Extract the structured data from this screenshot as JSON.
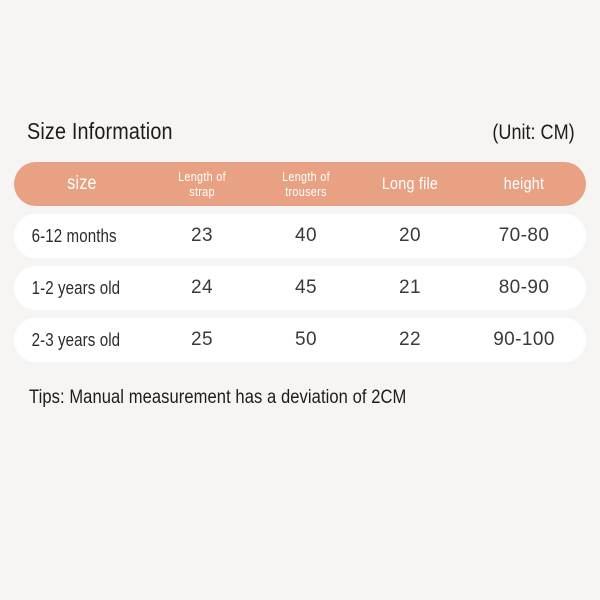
{
  "page": {
    "background_color": "#F7F5F4",
    "text_color": "#1C1C1C"
  },
  "header": {
    "title": "Size Information",
    "unit_note": "(Unit: CM)"
  },
  "table": {
    "accent_color": "#E8A182",
    "row_background": "#FFFFFF",
    "columns": [
      {
        "label": "size",
        "line1": "size",
        "line2": ""
      },
      {
        "label": "Length of strap",
        "line1": "Length of",
        "line2": "strap"
      },
      {
        "label": "Length of trousers",
        "line1": "Length of",
        "line2": "trousers"
      },
      {
        "label": "Long file",
        "line1": "Long file",
        "line2": ""
      },
      {
        "label": "height",
        "line1": "height",
        "line2": ""
      }
    ],
    "rows": [
      {
        "size": "6-12 months",
        "length_of_strap": "23",
        "length_of_trousers": "40",
        "long_file": "20",
        "height": "70-80"
      },
      {
        "size": "1-2 years old",
        "length_of_strap": "24",
        "length_of_trousers": "45",
        "long_file": "21",
        "height": "80-90"
      },
      {
        "size": "2-3 years old",
        "length_of_strap": "25",
        "length_of_trousers": "50",
        "long_file": "22",
        "height": "90-100"
      }
    ]
  },
  "footer": {
    "tips": "Tips: Manual measurement has a deviation of 2CM"
  }
}
